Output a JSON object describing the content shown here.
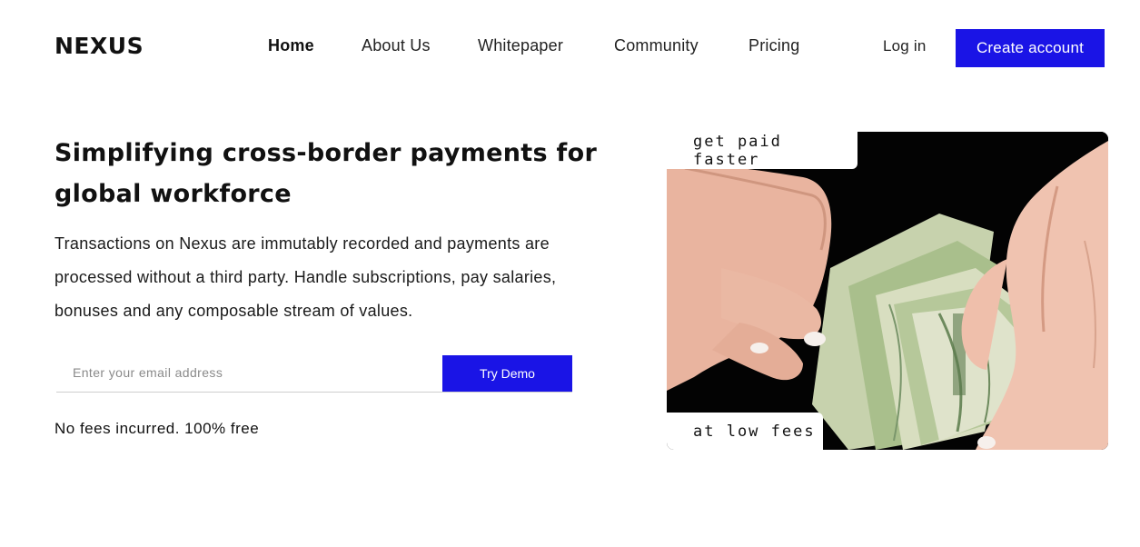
{
  "header": {
    "logo": "NEXUS",
    "nav": [
      {
        "label": "Home",
        "active": true
      },
      {
        "label": "About Us",
        "active": false
      },
      {
        "label": "Whitepaper",
        "active": false
      },
      {
        "label": "Community",
        "active": false
      },
      {
        "label": "Pricing",
        "active": false
      }
    ],
    "login_label": "Log in",
    "create_account_label": "Create account"
  },
  "hero": {
    "headline": "Simplifying cross-border payments for global workforce",
    "subtext": "Transactions on Nexus are immutably recorded and payments are processed without a third party. Handle subscriptions, pay salaries, bonuses and any composable stream of values.",
    "email_placeholder": "Enter your email address",
    "email_value": "",
    "try_demo_label": "Try Demo",
    "fee_note": "No fees incurred. 100% free"
  },
  "image_card": {
    "tag_top": "get paid faster",
    "tag_bottom": "at low fees",
    "photo_subject": "hands-counting-dollar-bills"
  },
  "colors": {
    "accent": "#1a14e6",
    "text": "#111111",
    "photo_background": "#020202"
  }
}
